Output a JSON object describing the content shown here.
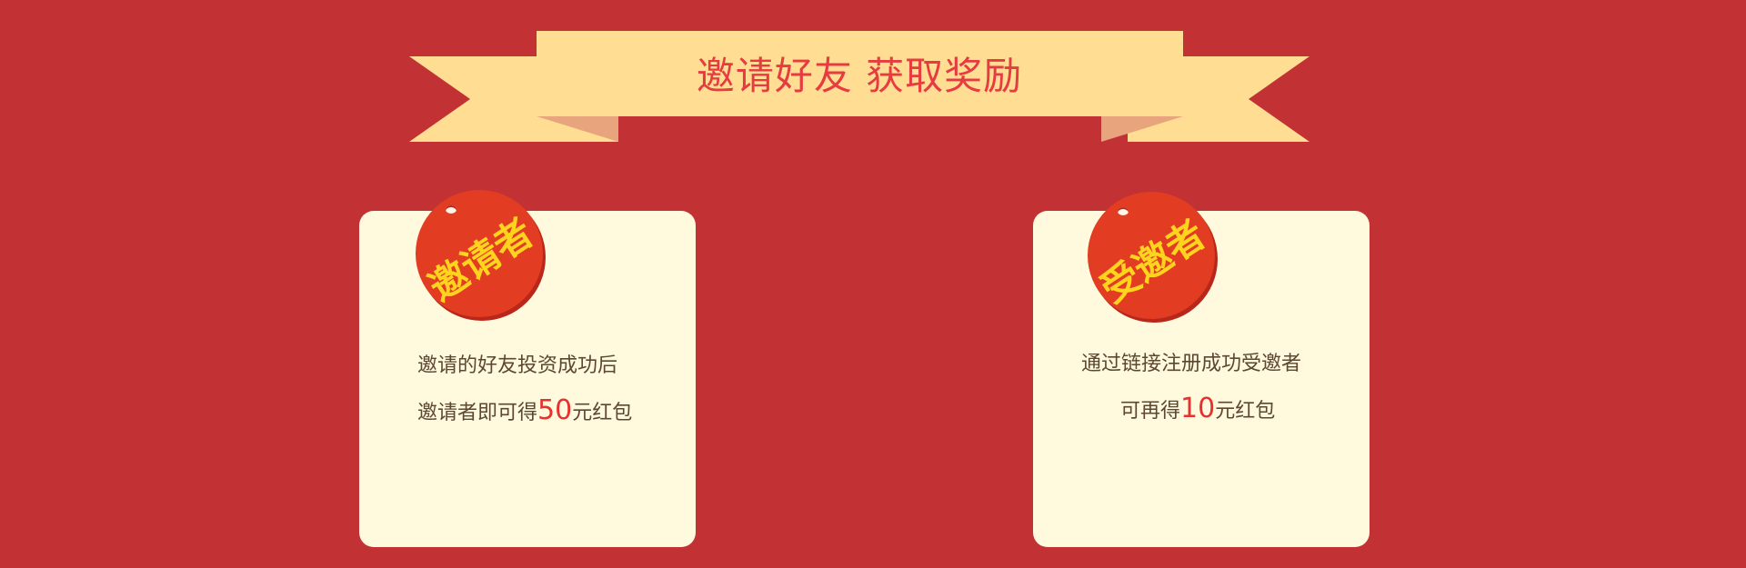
{
  "colors": {
    "background": "#c23234",
    "ribbon": "#ffdd93",
    "ribbon_shadow": "#e7a47d",
    "title_text": "#e63c41",
    "card": "#fff9dd",
    "tag": "#e23c22",
    "tag_text": "#ffd31e",
    "body_text": "#5b4733",
    "highlight_number": "#e7312f"
  },
  "banner": {
    "title": "邀请好友 获取奖励"
  },
  "cards": [
    {
      "tag": "邀请者",
      "line1": "邀请的好友投资成功后",
      "line2_prefix": "邀请者即可得",
      "amount": "50",
      "line2_suffix": "元红包"
    },
    {
      "tag": "受邀者",
      "line1": "通过链接注册成功受邀者",
      "line2_prefix": "可再得",
      "amount": "10",
      "line2_suffix": "元红包"
    }
  ]
}
